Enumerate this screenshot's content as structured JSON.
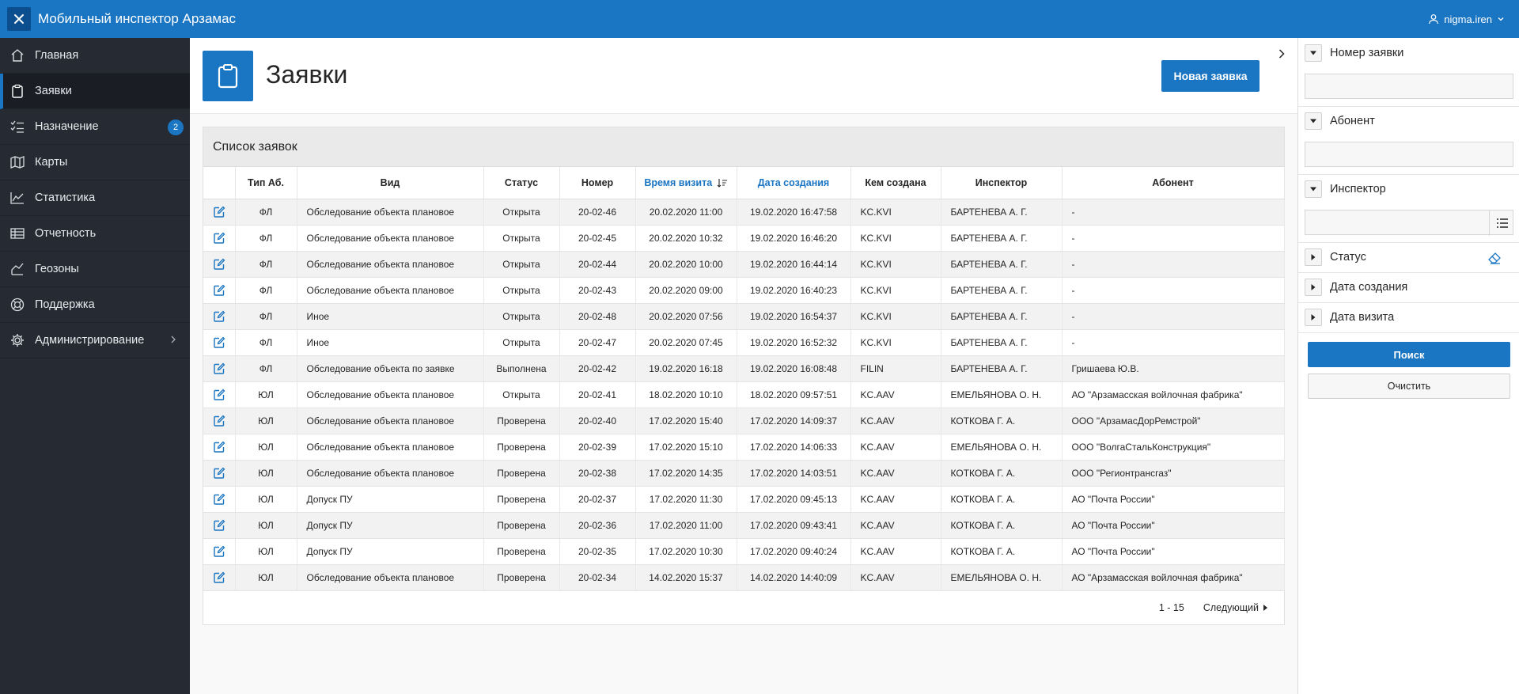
{
  "app": {
    "title": "Мобильный инспектор Арзамас",
    "user": "nigma.iren"
  },
  "sidebar": {
    "items": [
      {
        "label": "Главная",
        "icon": "home-icon"
      },
      {
        "label": "Заявки",
        "icon": "clipboard-icon",
        "active": true
      },
      {
        "label": "Назначение",
        "icon": "checklist-icon",
        "badge": "2"
      },
      {
        "label": "Карты",
        "icon": "map-icon"
      },
      {
        "label": "Статистика",
        "icon": "line-chart-icon"
      },
      {
        "label": "Отчетность",
        "icon": "table-icon"
      },
      {
        "label": "Геозоны",
        "icon": "geozone-icon"
      },
      {
        "label": "Поддержка",
        "icon": "lifebuoy-icon"
      },
      {
        "label": "Администрирование",
        "icon": "gear-icon",
        "has_children": true
      }
    ]
  },
  "page": {
    "title": "Заявки",
    "new_button": "Новая заявка"
  },
  "report": {
    "title": "Список заявок",
    "columns": [
      "",
      "Тип Аб.",
      "Вид",
      "Статус",
      "Номер",
      "Время визита",
      "Дата создания",
      "Кем создана",
      "Инспектор",
      "Абонент"
    ],
    "rows": [
      [
        "ФЛ",
        "Обследование объекта плановое",
        "Открыта",
        "20-02-46",
        "20.02.2020 11:00",
        "19.02.2020 16:47:58",
        "KC.KVI",
        "БАРТЕНЕВА А. Г.",
        "-"
      ],
      [
        "ФЛ",
        "Обследование объекта плановое",
        "Открыта",
        "20-02-45",
        "20.02.2020 10:32",
        "19.02.2020 16:46:20",
        "KC.KVI",
        "БАРТЕНЕВА А. Г.",
        "-"
      ],
      [
        "ФЛ",
        "Обследование объекта плановое",
        "Открыта",
        "20-02-44",
        "20.02.2020 10:00",
        "19.02.2020 16:44:14",
        "KC.KVI",
        "БАРТЕНЕВА А. Г.",
        "-"
      ],
      [
        "ФЛ",
        "Обследование объекта плановое",
        "Открыта",
        "20-02-43",
        "20.02.2020 09:00",
        "19.02.2020 16:40:23",
        "KC.KVI",
        "БАРТЕНЕВА А. Г.",
        "-"
      ],
      [
        "ФЛ",
        "Иное",
        "Открыта",
        "20-02-48",
        "20.02.2020 07:56",
        "19.02.2020 16:54:37",
        "KC.KVI",
        "БАРТЕНЕВА А. Г.",
        "-"
      ],
      [
        "ФЛ",
        "Иное",
        "Открыта",
        "20-02-47",
        "20.02.2020 07:45",
        "19.02.2020 16:52:32",
        "KC.KVI",
        "БАРТЕНЕВА А. Г.",
        "-"
      ],
      [
        "ФЛ",
        "Обследование объекта по заявке",
        "Выполнена",
        "20-02-42",
        "19.02.2020 16:18",
        "19.02.2020 16:08:48",
        "FILIN",
        "БАРТЕНЕВА А. Г.",
        "Гришаева Ю.В."
      ],
      [
        "ЮЛ",
        "Обследование объекта плановое",
        "Открыта",
        "20-02-41",
        "18.02.2020 10:10",
        "18.02.2020 09:57:51",
        "KC.AAV",
        "ЕМЕЛЬЯНОВА О. Н.",
        "АО \"Арзамасская войлочная фабрика\""
      ],
      [
        "ЮЛ",
        "Обследование объекта плановое",
        "Проверена",
        "20-02-40",
        "17.02.2020 15:40",
        "17.02.2020 14:09:37",
        "KC.AAV",
        "КОТКОВА Г. А.",
        "ООО \"АрзамасДорРемстрой\""
      ],
      [
        "ЮЛ",
        "Обследование объекта плановое",
        "Проверена",
        "20-02-39",
        "17.02.2020 15:10",
        "17.02.2020 14:06:33",
        "KC.AAV",
        "ЕМЕЛЬЯНОВА О. Н.",
        "ООО \"ВолгаСтальКонструкция\""
      ],
      [
        "ЮЛ",
        "Обследование объекта плановое",
        "Проверена",
        "20-02-38",
        "17.02.2020 14:35",
        "17.02.2020 14:03:51",
        "KC.AAV",
        "КОТКОВА Г. А.",
        "ООО \"Регионтрансгаз\""
      ],
      [
        "ЮЛ",
        "Допуск ПУ",
        "Проверена",
        "20-02-37",
        "17.02.2020 11:30",
        "17.02.2020 09:45:13",
        "KC.AAV",
        "КОТКОВА Г. А.",
        "АО \"Почта России\""
      ],
      [
        "ЮЛ",
        "Допуск ПУ",
        "Проверена",
        "20-02-36",
        "17.02.2020 11:00",
        "17.02.2020 09:43:41",
        "KC.AAV",
        "КОТКОВА Г. А.",
        "АО \"Почта России\""
      ],
      [
        "ЮЛ",
        "Допуск ПУ",
        "Проверена",
        "20-02-35",
        "17.02.2020 10:30",
        "17.02.2020 09:40:24",
        "KC.AAV",
        "КОТКОВА Г. А.",
        "АО \"Почта России\""
      ],
      [
        "ЮЛ",
        "Обследование объекта плановое",
        "Проверена",
        "20-02-34",
        "14.02.2020 15:37",
        "14.02.2020 14:40:09",
        "KC.AAV",
        "ЕМЕЛЬЯНОВА О. Н.",
        "АО \"Арзамасская войлочная фабрика\""
      ]
    ],
    "pagination": {
      "range": "1 - 15",
      "next": "Следующий"
    }
  },
  "facets": {
    "number": {
      "label": "Номер заявки"
    },
    "subscriber": {
      "label": "Абонент"
    },
    "inspector": {
      "label": "Инспектор"
    },
    "status": {
      "label": "Статус"
    },
    "created": {
      "label": "Дата создания"
    },
    "visit": {
      "label": "Дата визита"
    },
    "search_button": "Поиск",
    "clear_button": "Очистить"
  },
  "colors": {
    "accent": "#1a75c2",
    "sidebar": "#262b33",
    "header": "#1a75c2"
  }
}
